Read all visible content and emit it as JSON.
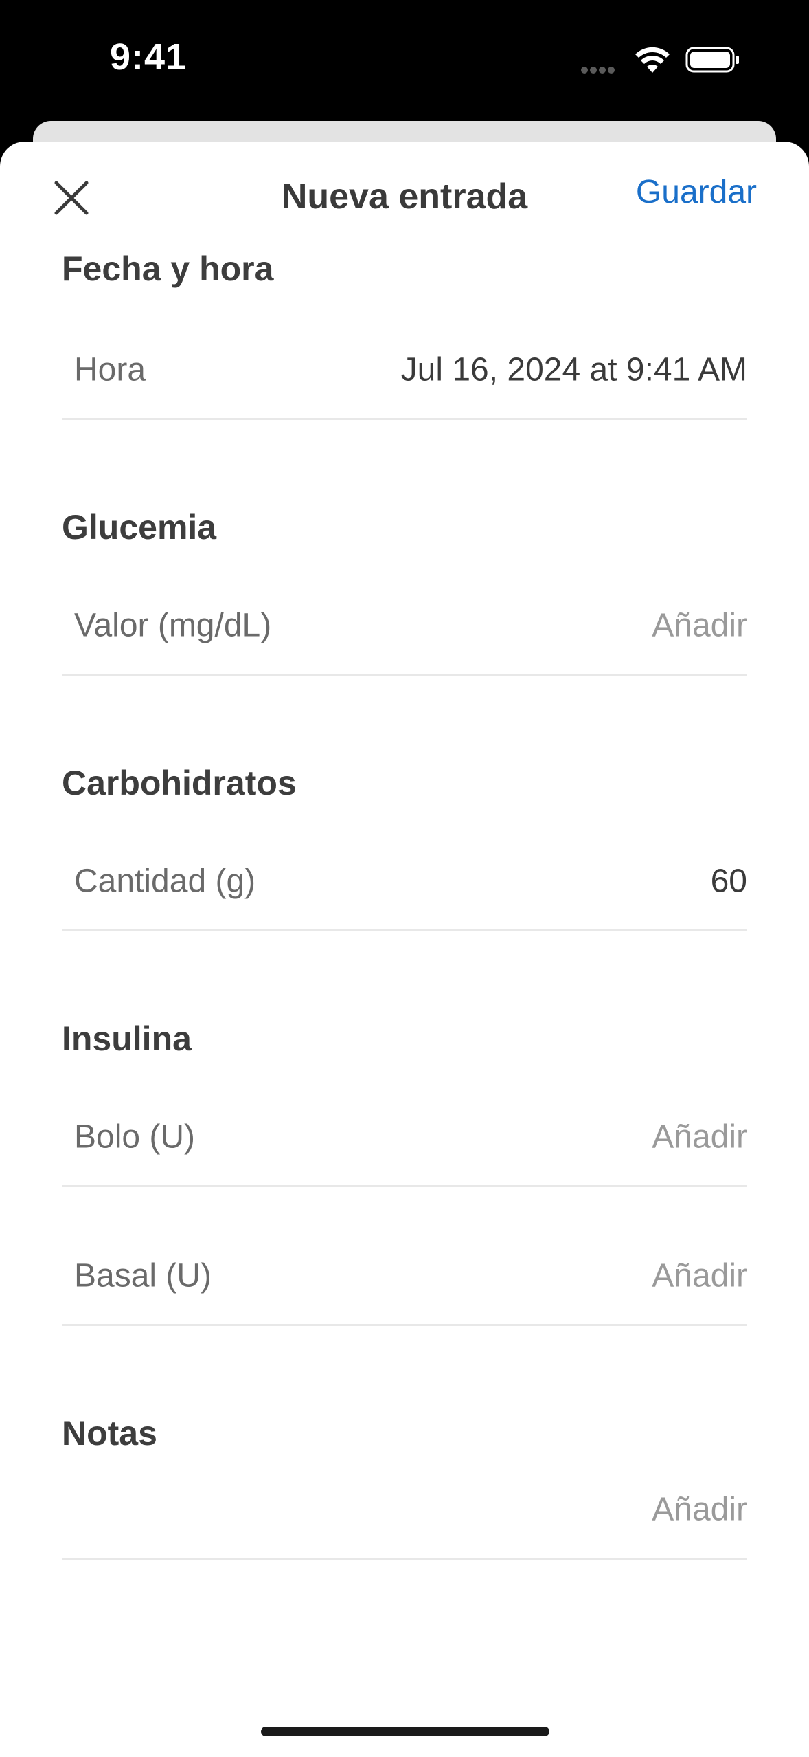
{
  "status_bar": {
    "time": "9:41"
  },
  "nav": {
    "title": "Nueva entrada",
    "save_label": "Guardar"
  },
  "sections": {
    "datetime": {
      "header": "Fecha y hora",
      "row_label": "Hora",
      "row_value": "Jul 16, 2024 at 9:41 AM"
    },
    "glucose": {
      "header": "Glucemia",
      "row_label": "Valor (mg/dL)",
      "row_value": "Añadir"
    },
    "carbs": {
      "header": "Carbohidratos",
      "row_label": "Cantidad (g)",
      "row_value": "60"
    },
    "insulin": {
      "header": "Insulina",
      "bolus_label": "Bolo (U)",
      "bolus_value": "Añadir",
      "basal_label": "Basal (U)",
      "basal_value": "Añadir"
    },
    "notes": {
      "header": "Notas",
      "row_value": "Añadir"
    }
  },
  "icons": {
    "close": "close-icon",
    "wifi": "wifi-icon",
    "battery": "battery-icon",
    "signal": "signal-icon"
  },
  "colors": {
    "accent": "#1a6fc9",
    "placeholder": "#9a9a9a"
  }
}
